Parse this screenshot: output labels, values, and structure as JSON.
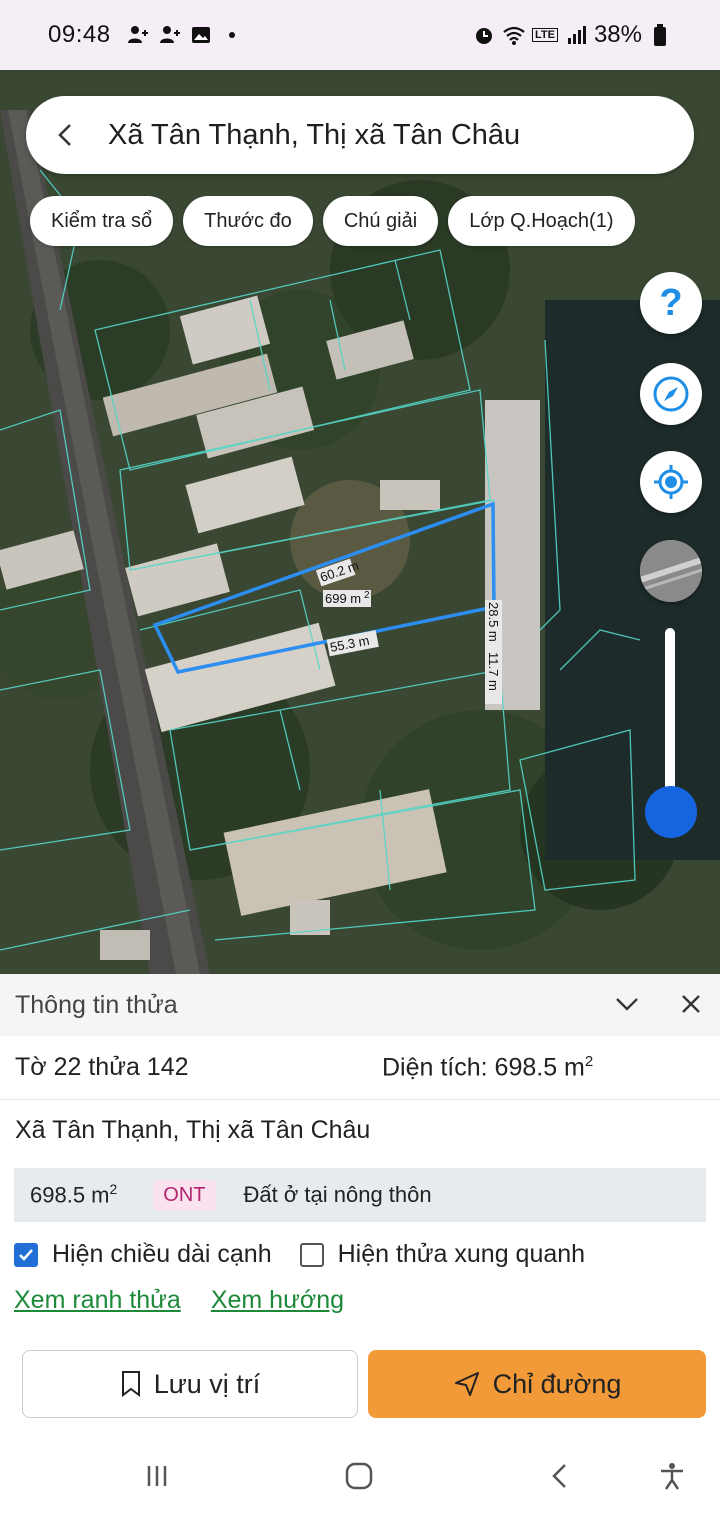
{
  "status": {
    "time": "09:48",
    "battery": "38%",
    "network": "LTE"
  },
  "header": {
    "title": "Xã Tân Thạnh, Thị xã Tân Châu"
  },
  "chips": [
    {
      "label": "Kiểm tra sổ"
    },
    {
      "label": "Thước đo"
    },
    {
      "label": "Chú giải"
    },
    {
      "label": "Lớp Q.Hoạch(1)"
    }
  ],
  "map_labels": {
    "top_edge": "60.2 m",
    "area": "699 m",
    "area_exp": "2",
    "bottom_edge": "55.3 m",
    "right_edge": "28.5 m",
    "right_edge_2": "11.7 m"
  },
  "panel": {
    "title": "Thông tin thửa",
    "parcel": "Tờ 22 thửa 142",
    "area_label": "Diện tích: 698.5 m",
    "area_exp": "2",
    "address": "Xã Tân Thạnh, Thị xã Tân Châu",
    "land_area": "698.5 m",
    "land_area_exp": "2",
    "land_code": "ONT",
    "land_type": "Đất ở tại nông thôn",
    "check_edges_label": "Hiện chiều dài cạnh",
    "check_edges_checked": true,
    "check_neighbors_label": "Hiện thửa xung quanh",
    "check_neighbors_checked": false,
    "link_boundary": "Xem ranh thửa",
    "link_direction": "Xem hướng",
    "save_label": "Lưu vị trí",
    "route_label": "Chỉ đường"
  },
  "colors": {
    "accent_blue": "#1565e0",
    "route_orange": "#f29a38",
    "link_green": "#1d8a3a",
    "parcel_outline": "#2b8ef0",
    "ont_bg": "#fbe2ef"
  },
  "icons": [
    "back-arrow-icon",
    "help-icon",
    "compass-icon",
    "locate-icon",
    "layer-thumb",
    "chevron-down-icon",
    "close-icon",
    "bookmark-icon",
    "send-icon",
    "recent-apps-icon",
    "home-icon",
    "back-icon",
    "accessibility-icon"
  ]
}
